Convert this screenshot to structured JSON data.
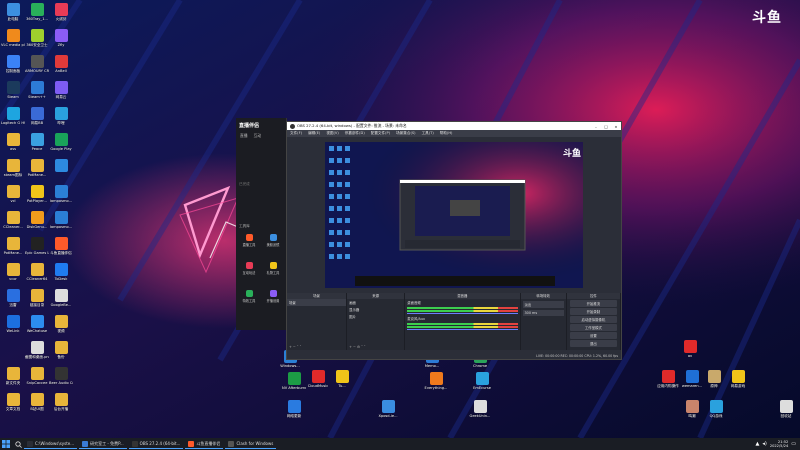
{
  "watermark": "斗鱼",
  "colors": {
    "accent": "#ff3a66",
    "obs_bg": "#2b2e38",
    "taskbar": "#1a1d24",
    "highlight": "#4aa3ff"
  },
  "desktop_left": [
    {
      "label": "此电脑",
      "icon": "computer-icon",
      "color": "#3c8fe0"
    },
    {
      "label": "360Tray_1...",
      "icon": "app-icon",
      "color": "#29b05a"
    },
    {
      "label": "火绒剑",
      "icon": "app-icon",
      "color": "#e83b56"
    },
    {
      "label": "VLC media player",
      "icon": "vlc-icon",
      "color": "#f08a1c"
    },
    {
      "label": "360安全卫士",
      "icon": "shield-icon",
      "color": "#9fcf2d"
    },
    {
      "label": "Zfly",
      "icon": "app-icon",
      "color": "#8b5cf6"
    },
    {
      "label": "控制面板",
      "icon": "settings-icon",
      "color": "#3b82f6"
    },
    {
      "label": "ARMOURY CRATE",
      "icon": "app-icon",
      "color": "#555"
    },
    {
      "label": "AnBell",
      "icon": "app-icon",
      "color": "#e03a3a"
    },
    {
      "label": "Steam",
      "icon": "steam-icon",
      "color": "#1b3a5c"
    },
    {
      "label": "Steam++",
      "icon": "app-icon",
      "color": "#2d7bd6"
    },
    {
      "label": "网易云",
      "icon": "app-icon",
      "color": "#7d5cf2"
    },
    {
      "label": "Logitech G HUB",
      "icon": "logitech-icon",
      "color": "#1ea5e0"
    },
    {
      "label": "网易BB",
      "icon": "app-icon",
      "color": "#3a6ad6"
    },
    {
      "label": "哔哩",
      "icon": "app-icon",
      "color": "#2aa1de"
    },
    {
      "label": "ass",
      "icon": "folder-icon",
      "color": "#e8b53a"
    },
    {
      "label": "Peace",
      "icon": "app-icon",
      "color": "#3aa0e0"
    },
    {
      "label": "Google Play",
      "icon": "play-icon",
      "color": "#19a35a"
    },
    {
      "label": "steam图标",
      "icon": "folder-icon",
      "color": "#e8b53a"
    },
    {
      "label": "PotMane...",
      "icon": "folder-icon",
      "color": "#e8b53a"
    },
    {
      "label": "",
      "icon": "star-icon",
      "color": "#2d8ae0"
    },
    {
      "label": "vcl",
      "icon": "folder-icon",
      "color": "#e8b53a"
    },
    {
      "label": "PotPlayer...",
      "icon": "app-icon",
      "color": "#f0c419"
    },
    {
      "label": "lamposmo...",
      "icon": "app-icon",
      "color": "#2b7fd6"
    },
    {
      "label": "CCleaner...",
      "icon": "folder-icon",
      "color": "#e8b53a"
    },
    {
      "label": "DiskGenu...",
      "icon": "app-icon",
      "color": "#f29b1c"
    },
    {
      "label": "lamposmo...",
      "icon": "app-icon",
      "color": "#2b7fd6"
    },
    {
      "label": "PotMane...",
      "icon": "folder-icon",
      "color": "#e8b53a"
    },
    {
      "label": "Epic Games Launcher",
      "icon": "epic-icon",
      "color": "#222"
    },
    {
      "label": "斗鱼直播伴侣",
      "icon": "douyu-icon",
      "color": "#ff5a2a"
    },
    {
      "label": "vcor",
      "icon": "folder-icon",
      "color": "#e8b53a"
    },
    {
      "label": "CCleaner64",
      "icon": "folder-icon",
      "color": "#e8b53a"
    },
    {
      "label": "ToDesk",
      "icon": "app-icon",
      "color": "#1f7bf0"
    },
    {
      "label": "迅雷",
      "icon": "app-icon",
      "color": "#2a6fe0"
    },
    {
      "label": "链接目录",
      "icon": "folder-icon",
      "color": "#e8b53a"
    },
    {
      "label": "GoogleBe...",
      "icon": "file-icon",
      "color": "#ddd"
    },
    {
      "label": "WeLink",
      "icon": "app-icon",
      "color": "#1c6fe0"
    },
    {
      "label": "WeChatuse",
      "icon": "app-icon",
      "color": "#2c8cef"
    },
    {
      "label": "视频",
      "icon": "folder-icon",
      "color": "#e8b53a"
    },
    {
      "label": "",
      "icon": "blank-icon",
      "color": "transparent"
    },
    {
      "label": "截图和桌面.png",
      "icon": "file-icon",
      "color": "#ddd"
    },
    {
      "label": "备份",
      "icon": "folder-icon",
      "color": "#e8b53a"
    },
    {
      "label": "新文件夹",
      "icon": "folder-icon",
      "color": "#e8b53a"
    },
    {
      "label": "SnipCaccee",
      "icon": "folder-icon",
      "color": "#e8b53a"
    },
    {
      "label": "Beer Audio Center",
      "icon": "audio-icon",
      "color": "#333"
    },
    {
      "label": "文章文档",
      "icon": "folder-icon",
      "color": "#e8b53a"
    },
    {
      "label": "B站UI图",
      "icon": "folder-icon",
      "color": "#e8b53a"
    },
    {
      "label": "后台开播",
      "icon": "folder-icon",
      "color": "#e8b53a"
    }
  ],
  "desktop_bottom": [
    {
      "label": "Windows...",
      "icon": "app-icon",
      "color": "#2b7fd6"
    },
    {
      "label": "",
      "icon": "blank-icon",
      "color": "transparent"
    },
    {
      "label": "Memo...",
      "icon": "app-icon",
      "color": "#2d7bd6"
    },
    {
      "label": "Chrome",
      "icon": "chrome-icon",
      "color": "#2aa35a"
    },
    {
      "label": "NV Afterburner",
      "icon": "app-icon",
      "color": "#1c9b45"
    },
    {
      "label": "CloudMusic",
      "icon": "music-icon",
      "color": "#e02a2a"
    },
    {
      "label": "Tu...",
      "icon": "app-icon",
      "color": "#f0c419"
    },
    {
      "label": "Everything...",
      "icon": "search-icon",
      "color": "#f07a1c"
    },
    {
      "label": "EmEcurse",
      "icon": "app-icon",
      "color": "#2aa1de"
    },
    {
      "label": "网络更新",
      "icon": "app-icon",
      "color": "#2a7be0"
    },
    {
      "label": "Xposd-ie...",
      "icon": "app-icon",
      "color": "#3a8de0"
    },
    {
      "label": "GeekUnin...",
      "icon": "recycle-icon",
      "color": "#ddd"
    }
  ],
  "desktop_right": [
    {
      "label": "av",
      "icon": "app-icon",
      "color": "#e02a2a"
    },
    {
      "label": "应用内购操作",
      "icon": "app-icon",
      "color": "#e02a2a"
    },
    {
      "label": "wemaren...",
      "icon": "app-icon",
      "color": "#1f6fd6"
    },
    {
      "label": "原神",
      "icon": "app-icon",
      "color": "#c9a96b"
    },
    {
      "label": "网易游戏",
      "icon": "app-icon",
      "color": "#f0c419"
    },
    {
      "label": "鸣潮",
      "icon": "app-icon",
      "color": "#c9846b"
    },
    {
      "label": "QQ游戏",
      "icon": "app-icon",
      "color": "#2aa1de"
    },
    {
      "label": "回收站",
      "icon": "recycle-icon",
      "color": "#ddd"
    }
  ],
  "douyu": {
    "brand": "直播伴侣",
    "tabs": [
      "直播",
      "互动"
    ],
    "status": "已完成",
    "section_tools": "工具库",
    "tools": [
      "直播工具",
      "美颜滤镜",
      "互动玩法",
      "礼物工具",
      "特效工具",
      "开播设置"
    ]
  },
  "obs": {
    "title": "OBS 27.2.4 (64-bit, windows) - 配置文件: 推流 - 场景: 未命名",
    "menu": [
      "文件(F)",
      "编辑(E)",
      "视图(V)",
      "停靠部件(D)",
      "配置文件(P)",
      "场景集合(S)",
      "工具(T)",
      "帮助(H)"
    ],
    "docks": {
      "scenes": {
        "title": "场景",
        "items": [
          "场景"
        ]
      },
      "sources": {
        "title": "来源",
        "items": [
          "画面",
          "显示器",
          "图片"
        ]
      },
      "mixer": {
        "title": "混音器",
        "channels": [
          "桌面音频",
          "麦克风/Aux"
        ]
      },
      "transitions": {
        "title": "转场特效",
        "type": "淡出",
        "duration": "300 ms"
      },
      "controls": {
        "title": "控件",
        "buttons": [
          "开始推流",
          "开始录制",
          "启动虚拟摄像机",
          "工作室模式",
          "设置",
          "退出"
        ]
      }
    },
    "status": "LIVE: 00:00:00 REC: 00:00:00 CPU: 1.2%, 60.00 fps"
  },
  "taskbar": {
    "items": [
      {
        "label": "C:\\Windows\\syste...",
        "color": "#2a2d36"
      },
      {
        "label": "研究室工 - 免费P...",
        "color": "#3a7bd5"
      },
      {
        "label": "OBS 27.2.4 (64-bit...",
        "color": "#333"
      },
      {
        "label": "斗鱼直播伴侣",
        "color": "#ff5a2a"
      },
      {
        "label": "Clash for Windows",
        "color": "#555"
      }
    ],
    "clock": {
      "time": "21:52",
      "date": "2022/5/24"
    }
  }
}
